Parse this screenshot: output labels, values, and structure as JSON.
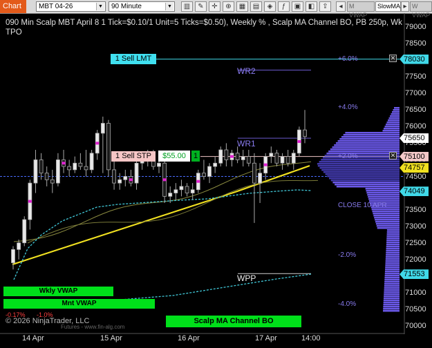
{
  "toolbar": {
    "tab_label": "Chart",
    "instrument": "MBT 04-26",
    "interval": "90 Minute",
    "indicators": [
      "M VWAP",
      "SlowMA",
      "W VWAP"
    ]
  },
  "chart": {
    "title_line1": "090 Min Scalp MBT April 8 1 Tick=$0.10/1 Unit=5 Ticks=$0.50), Weekly % , Scalp MA Channel BO, PB 250p, Wk",
    "title_line2": "TPO",
    "copyright": "© 2026 NinjaTrader, LLC",
    "watermark": "Futures - www.fin-alg.com",
    "pct_labels": [
      "+6.0%",
      "+4.0%",
      "+2.0%",
      "-2.0%",
      "-4.0%"
    ],
    "pct_small": "-0.17%",
    "pct_small2": "-1.0%",
    "level_labels": {
      "wr2": "WR2",
      "wr1": "WR1",
      "wpp": "WPP",
      "close": "CLOSE 10 APR"
    },
    "orders": {
      "sell_lmt": "1 Sell LMT",
      "sell_stp": "1 Sell STP",
      "pnl": "$55.00",
      "qty": "1"
    },
    "boxes": {
      "wkly_vwap": "Wkly VWAP",
      "mnt_vwap": "Mnt VWAP",
      "scalp": "Scalp MA Channel BO"
    },
    "y_axis": [
      "79000",
      "78500",
      "78000",
      "77500",
      "77000",
      "76500",
      "76000",
      "75500",
      "75000",
      "74500",
      "74000",
      "73500",
      "73000",
      "72500",
      "72000",
      "71500",
      "71000",
      "70500",
      "70000"
    ],
    "price_tags": [
      {
        "value": "78030",
        "color": "#40d8e8"
      },
      {
        "value": "75650",
        "color": "#ffffff"
      },
      {
        "value": "75100",
        "color": "#f3c8c8"
      },
      {
        "value": "74757",
        "color": "#f0e020"
      },
      {
        "value": "74049",
        "color": "#40d8e8"
      },
      {
        "value": "71553",
        "color": "#40d8e8"
      }
    ],
    "x_axis": [
      "14 Apr",
      "15 Apr",
      "16 Apr",
      "17 Apr",
      "14:00"
    ]
  },
  "chart_data": {
    "type": "candlestick",
    "ylim": [
      69800,
      79300
    ],
    "candles": [
      {
        "o": 71900,
        "h": 72400,
        "l": 71700,
        "c": 72300
      },
      {
        "o": 72300,
        "h": 72600,
        "l": 72000,
        "c": 72500
      },
      {
        "o": 72500,
        "h": 73300,
        "l": 72400,
        "c": 73200
      },
      {
        "o": 73200,
        "h": 74400,
        "l": 72900,
        "c": 74300
      },
      {
        "o": 74300,
        "h": 75300,
        "l": 74000,
        "c": 75000
      },
      {
        "o": 75000,
        "h": 75200,
        "l": 74400,
        "c": 74600
      },
      {
        "o": 74600,
        "h": 74800,
        "l": 74200,
        "c": 74400
      },
      {
        "o": 74400,
        "h": 74700,
        "l": 74000,
        "c": 74300
      },
      {
        "o": 74300,
        "h": 75200,
        "l": 74200,
        "c": 75000
      },
      {
        "o": 75000,
        "h": 75300,
        "l": 74600,
        "c": 74800
      },
      {
        "o": 74800,
        "h": 75000,
        "l": 74500,
        "c": 74700
      },
      {
        "o": 74700,
        "h": 75100,
        "l": 74600,
        "c": 74900
      },
      {
        "o": 74900,
        "h": 75200,
        "l": 74700,
        "c": 74800
      },
      {
        "o": 74800,
        "h": 75300,
        "l": 74500,
        "c": 74700
      },
      {
        "o": 74700,
        "h": 75300,
        "l": 74600,
        "c": 75200
      },
      {
        "o": 75200,
        "h": 75900,
        "l": 75000,
        "c": 75800
      },
      {
        "o": 75800,
        "h": 76300,
        "l": 74600,
        "c": 76100
      },
      {
        "o": 76100,
        "h": 76200,
        "l": 74500,
        "c": 74700
      },
      {
        "o": 74700,
        "h": 75000,
        "l": 74100,
        "c": 74300
      },
      {
        "o": 74300,
        "h": 74600,
        "l": 74100,
        "c": 74400
      },
      {
        "o": 74400,
        "h": 74700,
        "l": 74200,
        "c": 74500
      },
      {
        "o": 74500,
        "h": 74700,
        "l": 74200,
        "c": 74300
      },
      {
        "o": 74300,
        "h": 75000,
        "l": 74100,
        "c": 74900
      },
      {
        "o": 74900,
        "h": 75100,
        "l": 74700,
        "c": 75000
      },
      {
        "o": 75000,
        "h": 75300,
        "l": 74800,
        "c": 75100
      },
      {
        "o": 75100,
        "h": 75300,
        "l": 74700,
        "c": 74800
      },
      {
        "o": 74800,
        "h": 75000,
        "l": 74600,
        "c": 74900
      },
      {
        "o": 74900,
        "h": 75000,
        "l": 73700,
        "c": 73900
      },
      {
        "o": 73900,
        "h": 74200,
        "l": 73700,
        "c": 74000
      },
      {
        "o": 74000,
        "h": 74300,
        "l": 73800,
        "c": 74100
      },
      {
        "o": 74100,
        "h": 74400,
        "l": 73900,
        "c": 74200
      },
      {
        "o": 74200,
        "h": 74300,
        "l": 73900,
        "c": 74000
      },
      {
        "o": 74000,
        "h": 74300,
        "l": 73800,
        "c": 74100
      },
      {
        "o": 74100,
        "h": 74700,
        "l": 74000,
        "c": 74600
      },
      {
        "o": 74600,
        "h": 75000,
        "l": 74400,
        "c": 74500
      },
      {
        "o": 74500,
        "h": 74900,
        "l": 74300,
        "c": 74800
      },
      {
        "o": 74800,
        "h": 75100,
        "l": 74600,
        "c": 74900
      },
      {
        "o": 74900,
        "h": 75400,
        "l": 74800,
        "c": 75300
      },
      {
        "o": 75300,
        "h": 75500,
        "l": 74800,
        "c": 75000
      },
      {
        "o": 75000,
        "h": 75300,
        "l": 74800,
        "c": 75200
      },
      {
        "o": 75200,
        "h": 75400,
        "l": 74900,
        "c": 75000
      },
      {
        "o": 75000,
        "h": 75300,
        "l": 74800,
        "c": 75100
      },
      {
        "o": 75100,
        "h": 75300,
        "l": 74800,
        "c": 74900
      },
      {
        "o": 74900,
        "h": 75200,
        "l": 73100,
        "c": 74300
      },
      {
        "o": 74300,
        "h": 74900,
        "l": 73700,
        "c": 74600
      },
      {
        "o": 74600,
        "h": 75200,
        "l": 74400,
        "c": 75100
      },
      {
        "o": 75100,
        "h": 75400,
        "l": 74900,
        "c": 75200
      },
      {
        "o": 75200,
        "h": 75300,
        "l": 74800,
        "c": 74900
      },
      {
        "o": 74900,
        "h": 75200,
        "l": 74700,
        "c": 75100
      },
      {
        "o": 75100,
        "h": 75300,
        "l": 74800,
        "c": 74900
      },
      {
        "o": 74900,
        "h": 75300,
        "l": 74700,
        "c": 75200
      },
      {
        "o": 75200,
        "h": 76000,
        "l": 75100,
        "c": 75900
      },
      {
        "o": 75900,
        "h": 76500,
        "l": 75500,
        "c": 75700
      }
    ],
    "levels": {
      "sell_lmt": 78030,
      "wr2": 77700,
      "wr1": 75650,
      "current": 75100,
      "ma": 74757,
      "blue_dashed": 74500,
      "wpp": 71553
    }
  }
}
